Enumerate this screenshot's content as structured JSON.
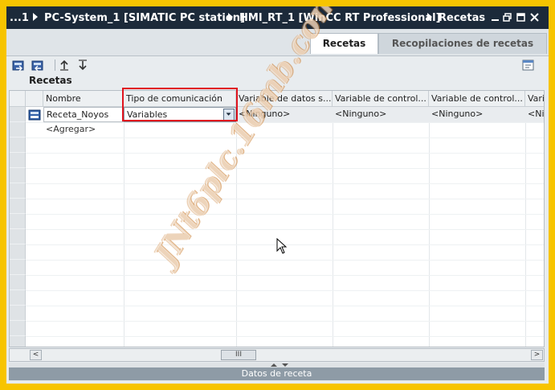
{
  "titlebar": {
    "ellipsis": "...1",
    "crumbs": [
      "PC-System_1 [SIMATIC PC station]",
      "HMI_RT_1 [WinCC RT Professional]",
      "Recetas"
    ]
  },
  "tabs": [
    "Recetas",
    "Recopilaciones de recetas"
  ],
  "section_title": "Recetas",
  "table": {
    "columns": [
      "Nombre",
      "Tipo de comunicación",
      "Variable de datos s...",
      "Variable de control...",
      "Variable de control...",
      "Varia"
    ],
    "row": {
      "name": "Receta_Noyos",
      "comm_type": "Variables",
      "var1": "<Ninguno>",
      "var2": "<Ninguno>",
      "var3": "<Ninguno>",
      "var4": "<Nin"
    },
    "add_row": "<Agregar>"
  },
  "scroll": {
    "left": "<",
    "right": ">",
    "thumb": "III"
  },
  "bottom_panel": "Datos de receta",
  "watermark": "JNt6plc.16mb.com",
  "colors": {
    "highlight": "#e0141e",
    "titlebar": "#1c2a3a",
    "frame": "#f7c400"
  }
}
